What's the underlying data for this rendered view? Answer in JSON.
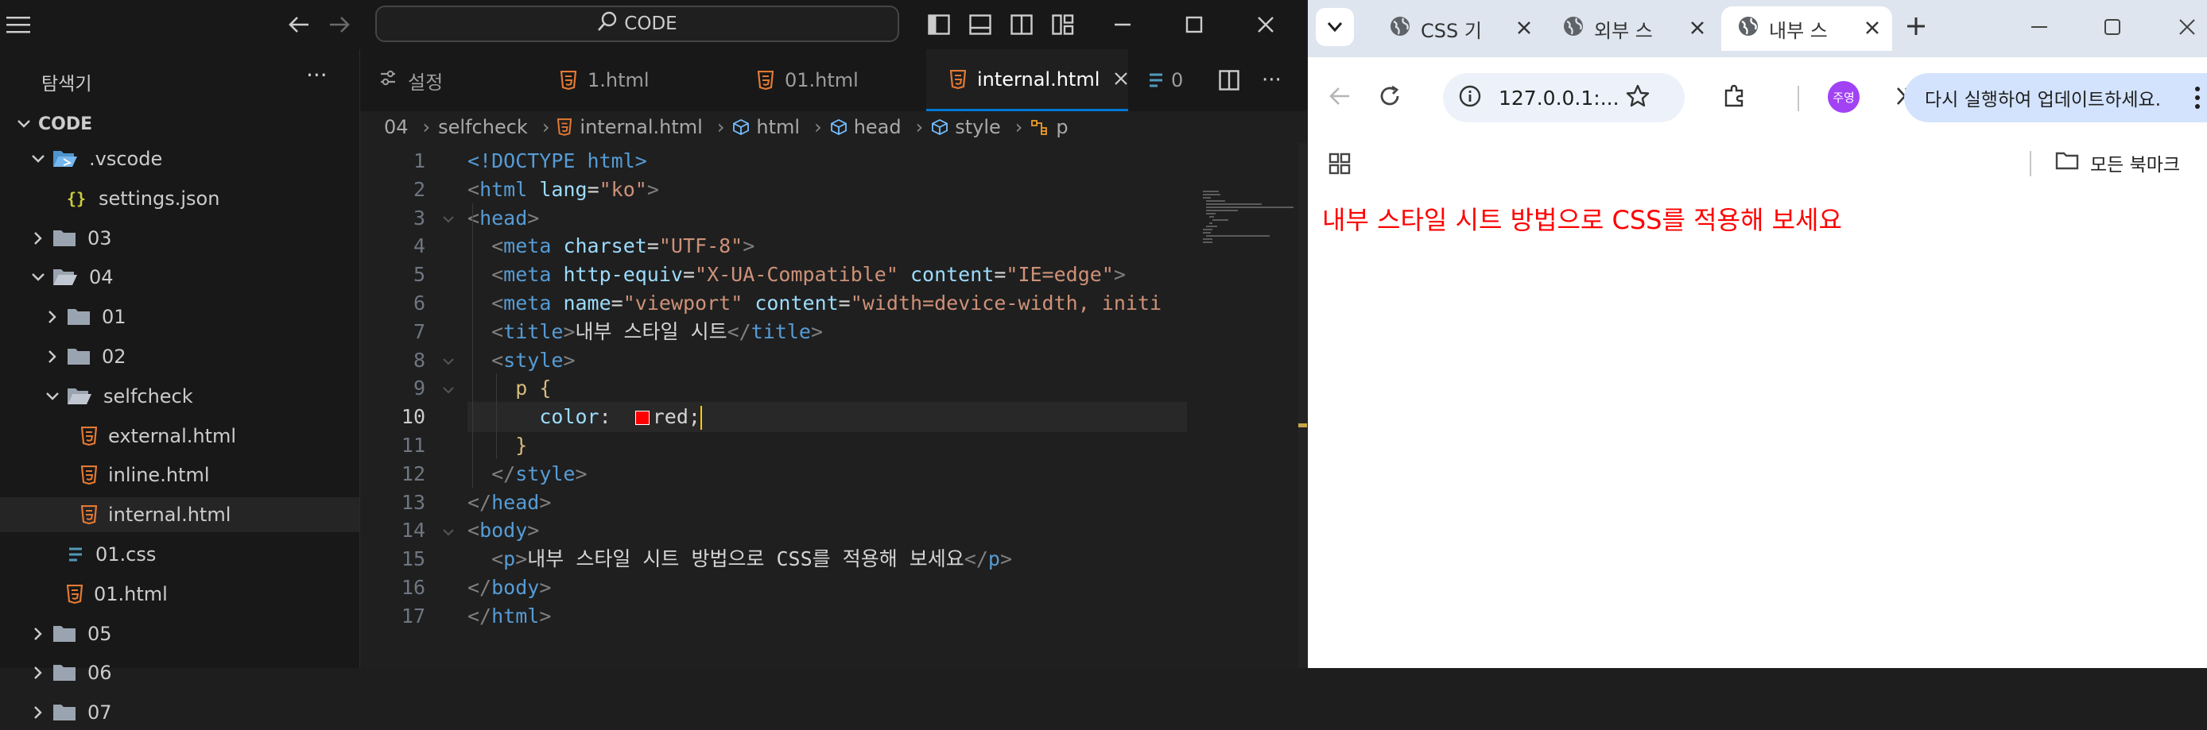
{
  "vscode": {
    "command_center_label": "CODE",
    "explorer_title": "탐색기",
    "workspace_name": "CODE",
    "tree": [
      {
        "label": ".vscode",
        "icon": "vscode-folder-icon",
        "indent": 1,
        "expanded": true,
        "folder": true
      },
      {
        "label": "settings.json",
        "icon": "json-icon",
        "indent": 2,
        "folder": false
      },
      {
        "label": "03",
        "icon": "folder-icon",
        "indent": 1,
        "expanded": false,
        "folder": true
      },
      {
        "label": "04",
        "icon": "folder-open-icon",
        "indent": 1,
        "expanded": true,
        "folder": true
      },
      {
        "label": "01",
        "icon": "folder-icon",
        "indent": 2,
        "expanded": false,
        "folder": true
      },
      {
        "label": "02",
        "icon": "folder-icon",
        "indent": 2,
        "expanded": false,
        "folder": true
      },
      {
        "label": "selfcheck",
        "icon": "folder-open-icon",
        "indent": 2,
        "expanded": true,
        "folder": true
      },
      {
        "label": "external.html",
        "icon": "html-icon",
        "indent": 3,
        "folder": false
      },
      {
        "label": "inline.html",
        "icon": "html-icon",
        "indent": 3,
        "folder": false
      },
      {
        "label": "internal.html",
        "icon": "html-icon",
        "indent": 3,
        "folder": false,
        "selected": true
      },
      {
        "label": "01.css",
        "icon": "css-icon",
        "indent": 2,
        "folder": false
      },
      {
        "label": "01.html",
        "icon": "html-icon",
        "indent": 2,
        "folder": false
      },
      {
        "label": "05",
        "icon": "folder-icon",
        "indent": 1,
        "expanded": false,
        "folder": true
      },
      {
        "label": "06",
        "icon": "folder-icon",
        "indent": 1,
        "expanded": false,
        "folder": true
      },
      {
        "label": "07",
        "icon": "folder-icon",
        "indent": 1,
        "expanded": false,
        "folder": true
      }
    ],
    "tabs": [
      {
        "label": "설정",
        "icon": "settings-icon"
      },
      {
        "label": "1.html",
        "icon": "html-icon"
      },
      {
        "label": "01.html",
        "icon": "html-icon"
      },
      {
        "label": "internal.html",
        "icon": "html-icon",
        "active": true
      },
      {
        "label": "0",
        "icon": "css-icon"
      }
    ],
    "breadcrumb": [
      "04",
      "selfcheck",
      "internal.html",
      "html",
      "head",
      "style",
      "p"
    ],
    "current_line": 10,
    "code_lines": [
      {
        "n": "1",
        "indent": "",
        "tokens": [
          [
            "tag",
            "<!DOCTYPE html>"
          ]
        ]
      },
      {
        "n": "2",
        "indent": "",
        "tokens": [
          [
            "bracket",
            "<"
          ],
          [
            "tag",
            "html"
          ],
          [
            "text",
            " "
          ],
          [
            "attr",
            "lang"
          ],
          [
            "text",
            "="
          ],
          [
            "str",
            "\"ko\""
          ],
          [
            "bracket",
            ">"
          ]
        ]
      },
      {
        "n": "3",
        "indent": "",
        "fold": true,
        "tokens": [
          [
            "bracket",
            "<"
          ],
          [
            "tag",
            "head"
          ],
          [
            "bracket",
            ">"
          ]
        ]
      },
      {
        "n": "4",
        "indent": "  ",
        "tokens": [
          [
            "bracket",
            "<"
          ],
          [
            "tag",
            "meta"
          ],
          [
            "text",
            " "
          ],
          [
            "attr",
            "charset"
          ],
          [
            "text",
            "="
          ],
          [
            "str",
            "\"UTF-8\""
          ],
          [
            "bracket",
            ">"
          ]
        ]
      },
      {
        "n": "5",
        "indent": "  ",
        "tokens": [
          [
            "bracket",
            "<"
          ],
          [
            "tag",
            "meta"
          ],
          [
            "text",
            " "
          ],
          [
            "attr",
            "http-equiv"
          ],
          [
            "text",
            "="
          ],
          [
            "str",
            "\"X-UA-Compatible\""
          ],
          [
            "text",
            " "
          ],
          [
            "attr",
            "content"
          ],
          [
            "text",
            "="
          ],
          [
            "str",
            "\"IE=edge\""
          ],
          [
            "bracket",
            ">"
          ]
        ]
      },
      {
        "n": "6",
        "indent": "  ",
        "tokens": [
          [
            "bracket",
            "<"
          ],
          [
            "tag",
            "meta"
          ],
          [
            "text",
            " "
          ],
          [
            "attr",
            "name"
          ],
          [
            "text",
            "="
          ],
          [
            "str",
            "\"viewport\""
          ],
          [
            "text",
            " "
          ],
          [
            "attr",
            "content"
          ],
          [
            "text",
            "="
          ],
          [
            "str",
            "\"width=device-width, initi"
          ]
        ]
      },
      {
        "n": "7",
        "indent": "  ",
        "tokens": [
          [
            "bracket",
            "<"
          ],
          [
            "tag",
            "title"
          ],
          [
            "bracket",
            ">"
          ],
          [
            "text",
            "내부 스타일 시트"
          ],
          [
            "bracket",
            "</"
          ],
          [
            "tag",
            "title"
          ],
          [
            "bracket",
            ">"
          ]
        ]
      },
      {
        "n": "8",
        "indent": "  ",
        "fold": true,
        "tokens": [
          [
            "bracket",
            "<"
          ],
          [
            "tag",
            "style"
          ],
          [
            "bracket",
            ">"
          ]
        ]
      },
      {
        "n": "9",
        "indent": "    ",
        "fold": true,
        "tokens": [
          [
            "sel",
            "p"
          ],
          [
            "text",
            " "
          ],
          [
            "sel",
            "{"
          ]
        ]
      },
      {
        "n": "10",
        "indent": "      ",
        "swatch": "#ff0000",
        "tokens": [
          [
            "prop",
            "color"
          ],
          [
            "text",
            ":  "
          ],
          [
            "text",
            "red;"
          ]
        ]
      },
      {
        "n": "11",
        "indent": "    ",
        "tokens": [
          [
            "sel",
            "}"
          ]
        ]
      },
      {
        "n": "12",
        "indent": "  ",
        "tokens": [
          [
            "bracket",
            "</"
          ],
          [
            "tag",
            "style"
          ],
          [
            "bracket",
            ">"
          ]
        ]
      },
      {
        "n": "13",
        "indent": "",
        "tokens": [
          [
            "bracket",
            "</"
          ],
          [
            "tag",
            "head"
          ],
          [
            "bracket",
            ">"
          ]
        ]
      },
      {
        "n": "14",
        "indent": "",
        "fold": true,
        "tokens": [
          [
            "bracket",
            "<"
          ],
          [
            "tag",
            "body"
          ],
          [
            "bracket",
            ">"
          ]
        ]
      },
      {
        "n": "15",
        "indent": "  ",
        "tokens": [
          [
            "bracket",
            "<"
          ],
          [
            "tag",
            "p"
          ],
          [
            "bracket",
            ">"
          ],
          [
            "text",
            "내부 스타일 시트 방법으로 CSS를 적용해 보세요"
          ],
          [
            "bracket",
            "</"
          ],
          [
            "tag",
            "p"
          ],
          [
            "bracket",
            ">"
          ]
        ]
      },
      {
        "n": "16",
        "indent": "",
        "tokens": [
          [
            "bracket",
            "</"
          ],
          [
            "tag",
            "body"
          ],
          [
            "bracket",
            ">"
          ]
        ]
      },
      {
        "n": "17",
        "indent": "",
        "tokens": [
          [
            "bracket",
            "</"
          ],
          [
            "tag",
            "html"
          ],
          [
            "bracket",
            ">"
          ]
        ]
      }
    ]
  },
  "browser": {
    "tabs": [
      {
        "label": "CSS 기",
        "active": false
      },
      {
        "label": "외부 스",
        "active": false
      },
      {
        "label": "내부 스",
        "active": true
      }
    ],
    "address": "127.0.0.1:...",
    "profile_initials": "주영",
    "update_label": "다시 실행하여 업데이트하세요.",
    "bookmarks_label": "모든 북마크",
    "page_paragraph": "내부 스타일 시트 방법으로 CSS를 적용해 보세요",
    "page_text_color": "#ff0000"
  },
  "colors": {
    "accent": "#0078d4",
    "html_icon": "#e37933",
    "css_icon": "#519aba",
    "json_icon": "#cbcb41",
    "vscode_folder": "#4e94ce"
  }
}
